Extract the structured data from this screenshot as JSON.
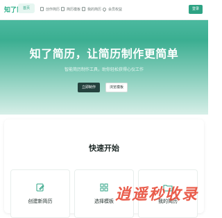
{
  "navbar": {
    "logo": "知了简历",
    "active_item": "首页",
    "items": [
      {
        "label": "创作简历",
        "icon": "document-icon"
      },
      {
        "label": "简历模板",
        "icon": "template-icon"
      },
      {
        "label": "我的简历",
        "icon": "folder-icon"
      },
      {
        "label": "会员权益",
        "icon": "location-pin-icon"
      }
    ],
    "login_label": "登录"
  },
  "hero": {
    "title": "知了简历，让简历制作更简单",
    "subtitle": "智能简历制作工具，助你轻松获得心仪工作",
    "primary_button": "立即制作",
    "secondary_button": "浏览模板"
  },
  "quick_start": {
    "title": "快速开始",
    "features": [
      {
        "label": "创建新简历",
        "icon": "edit-icon"
      },
      {
        "label": "选择模板",
        "icon": "grid-icon"
      },
      {
        "label": "我的简历",
        "icon": "folder-icon"
      }
    ]
  },
  "watermark": "逍遥秒收录",
  "colors": {
    "accent": "#34b28e",
    "primary_button": "#24423e",
    "watermark": "#e64632"
  }
}
